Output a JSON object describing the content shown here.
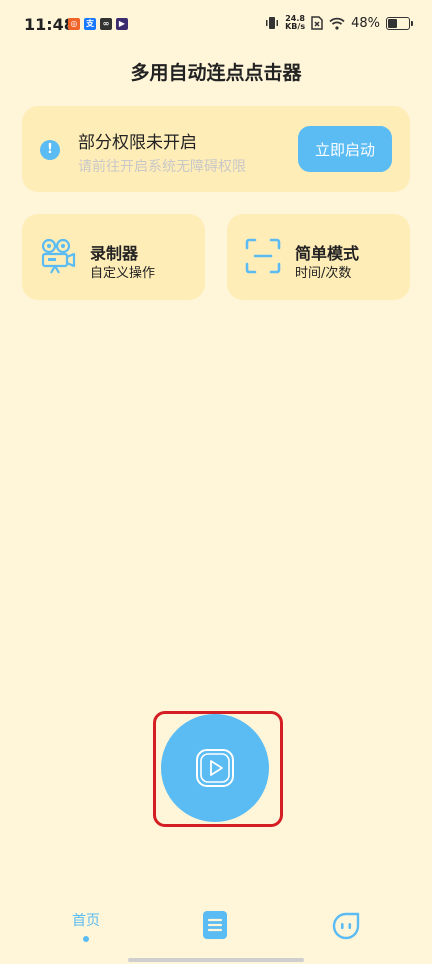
{
  "status_bar": {
    "time": "11:48",
    "net_speed_value": "24.8",
    "net_speed_unit": "KB/s",
    "battery_percent": "48%",
    "app_icons": [
      "mi-app-icon",
      "alipay-icon",
      "link-app-icon",
      "video-app-icon"
    ]
  },
  "page": {
    "title": "多用自动连点点击器"
  },
  "permission_card": {
    "title": "部分权限未开启",
    "subtitle": "请前往开启系统无障碍权限",
    "button_label": "立即启动"
  },
  "features": [
    {
      "title": "录制器",
      "subtitle": "自定义操作",
      "icon": "video-camera-icon"
    },
    {
      "title": "简单模式",
      "subtitle": "时间/次数",
      "icon": "scan-frame-icon"
    }
  ],
  "play_button": {
    "icon": "play-icon"
  },
  "tab_bar": {
    "items": [
      {
        "label": "首页",
        "icon": "home-tab",
        "active": true
      },
      {
        "label": "",
        "icon": "list-icon",
        "active": false
      },
      {
        "label": "",
        "icon": "smiley-face-icon",
        "active": false
      }
    ]
  },
  "colors": {
    "background": "#FFF6DA",
    "card": "#FFEDB8",
    "accent": "#5BBBF3",
    "highlight_outline": "#D41E23"
  }
}
